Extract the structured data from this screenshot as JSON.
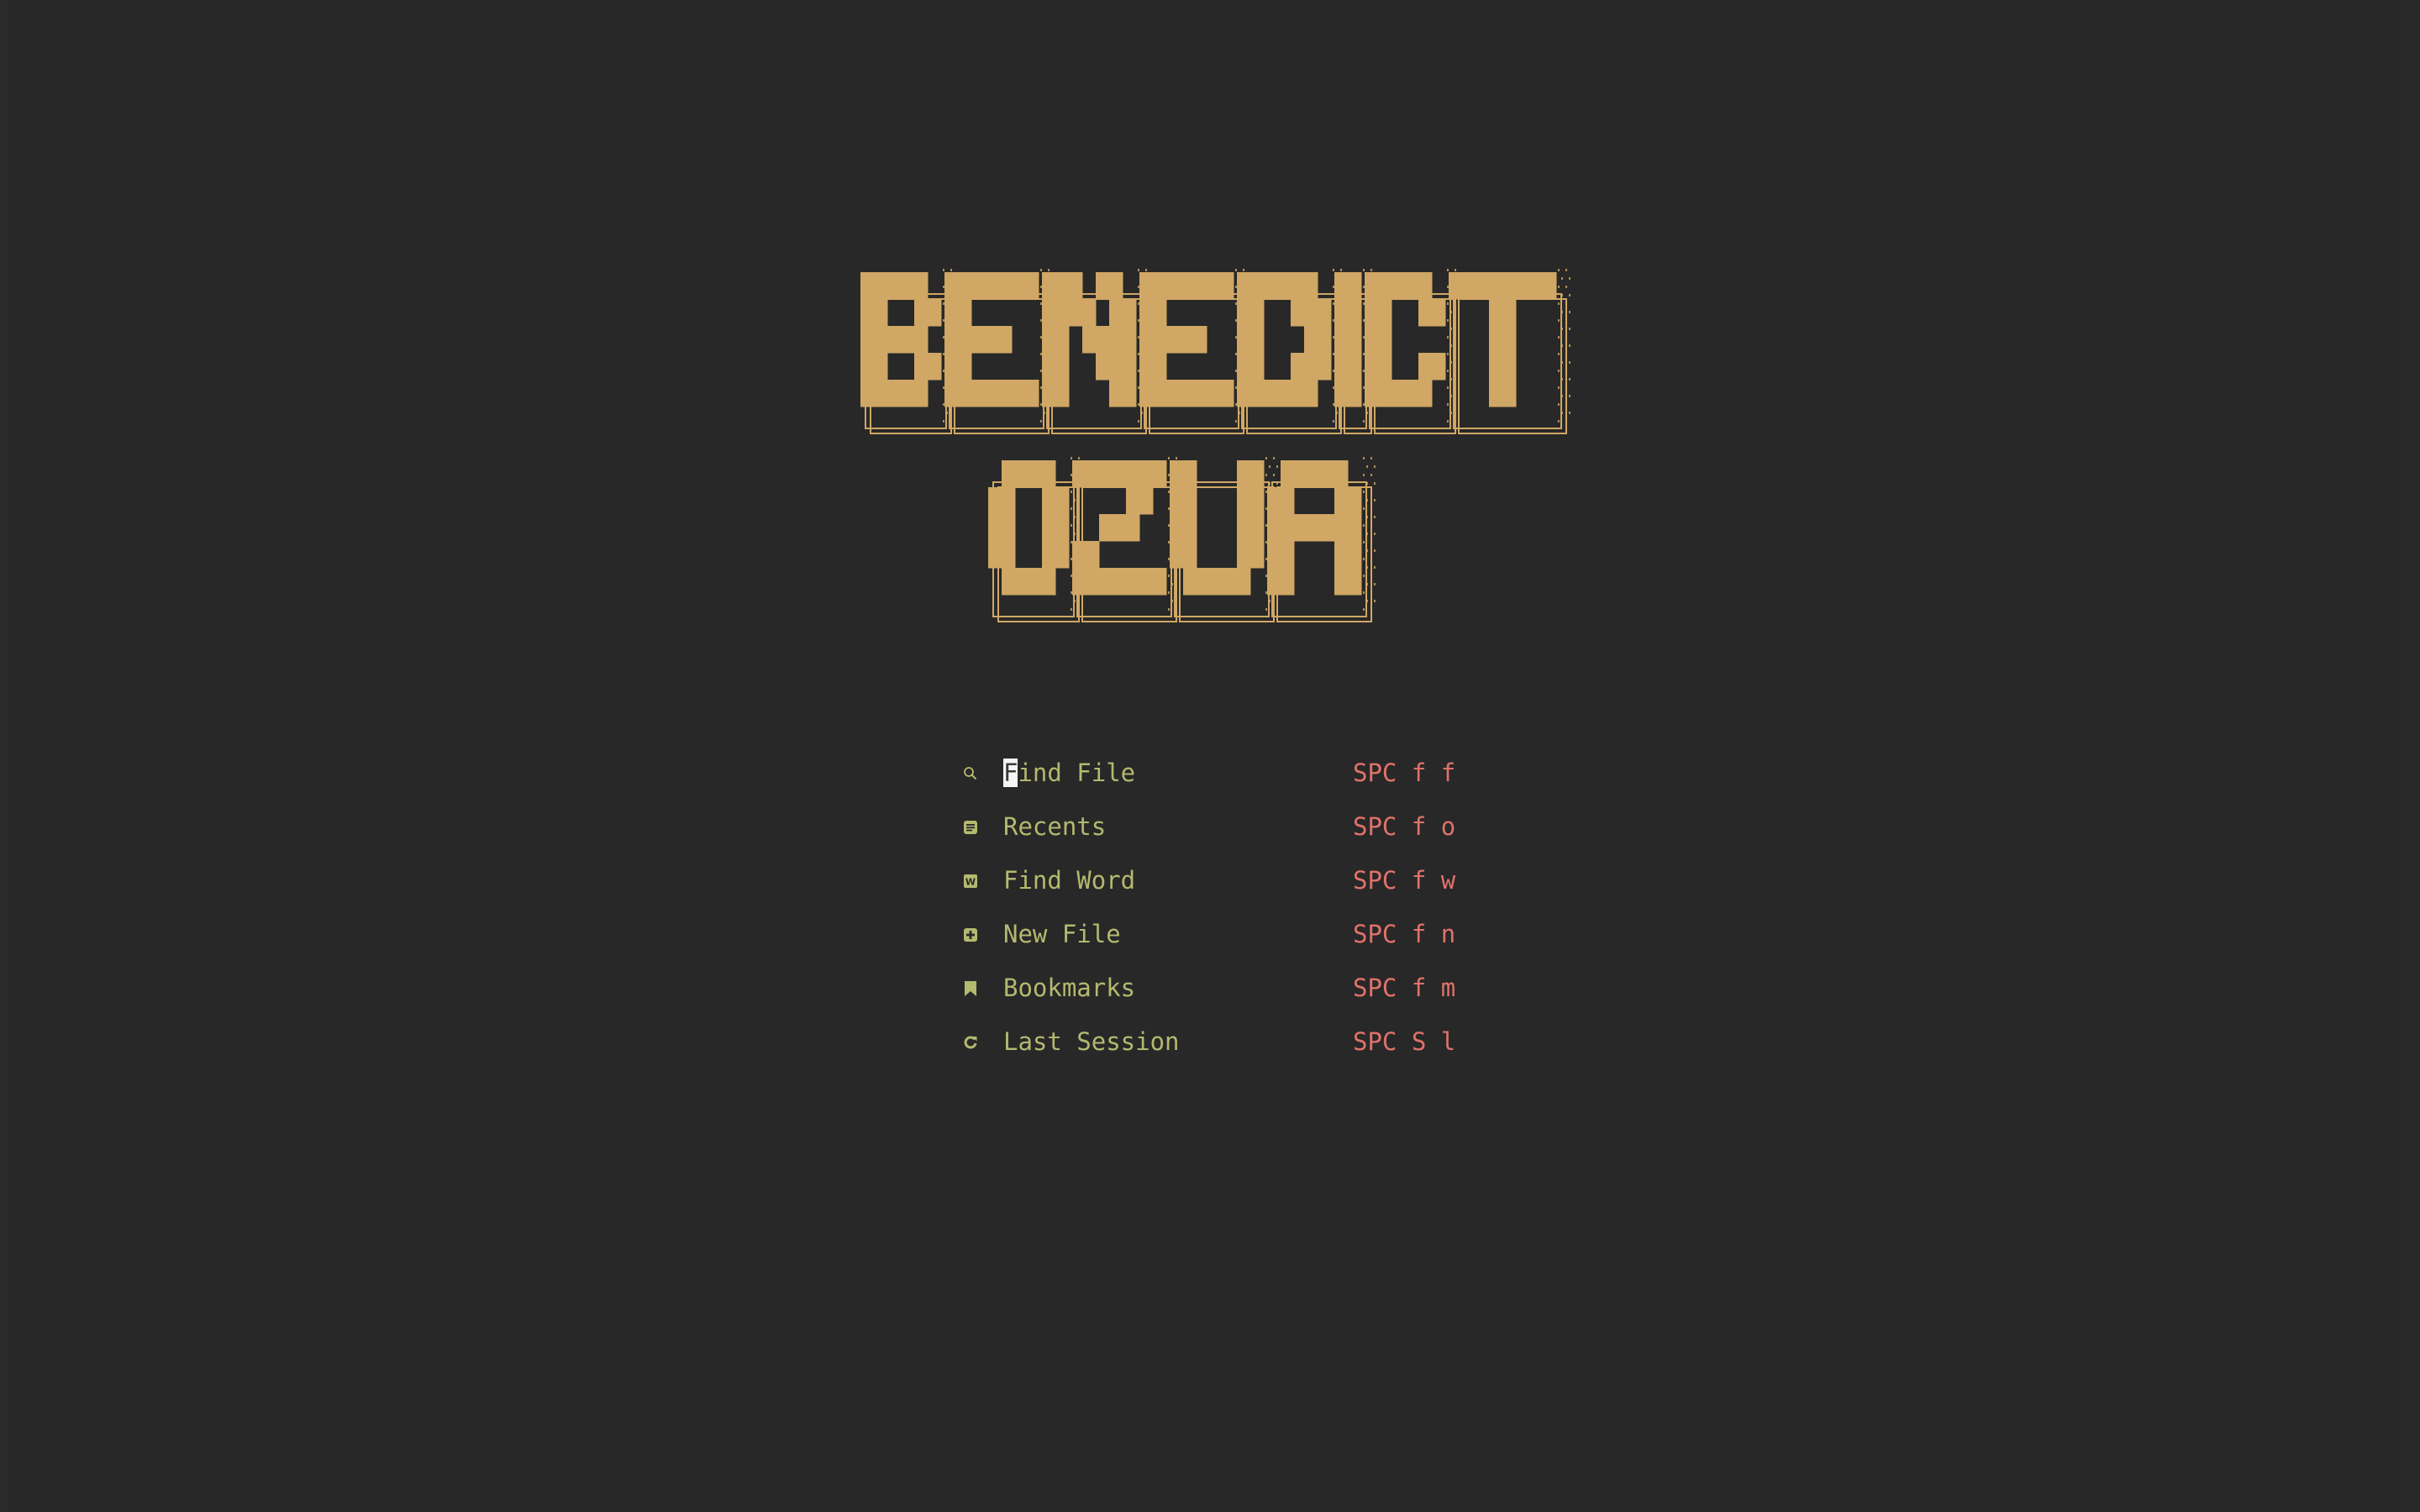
{
  "app": "Neovim dashboard",
  "colors": {
    "background": "#282828",
    "banner": "#d0a765",
    "menu_label": "#b3b96f",
    "menu_icon": "#b3b96f",
    "shortcut": "#e0726a",
    "cursor_bg": "#f5f5f5"
  },
  "banner": {
    "line1": "BENEDICT",
    "line2": "OZUA"
  },
  "menu": {
    "items": [
      {
        "icon": "search-icon",
        "label": "Find File",
        "shortcut": "SPC f f",
        "cursor_char": "F",
        "label_rest": "ind File"
      },
      {
        "icon": "document-icon",
        "label": "Recents",
        "shortcut": "SPC f o"
      },
      {
        "icon": "word-icon",
        "icon_text": "W",
        "label": "Find Word",
        "shortcut": "SPC f w"
      },
      {
        "icon": "plus-square-icon",
        "label": "New File",
        "shortcut": "SPC f n"
      },
      {
        "icon": "bookmark-icon",
        "label": "Bookmarks",
        "shortcut": "SPC f m"
      },
      {
        "icon": "refresh-icon",
        "label": "Last Session",
        "shortcut": "SPC S l"
      }
    ]
  }
}
